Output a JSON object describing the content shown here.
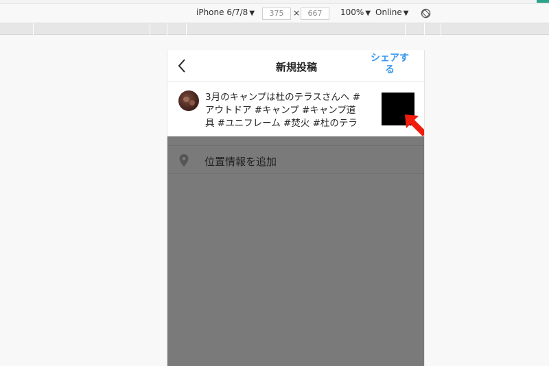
{
  "devtools": {
    "device": "iPhone 6/7/8",
    "width": "375",
    "height": "667",
    "dimension_separator": "×",
    "zoom": "100%",
    "network": "Online",
    "dropdown_glyph": "▼"
  },
  "post": {
    "title": "新規投稿",
    "share_label": "シェアする",
    "caption": "3月のキャンプは杜のテラスさんへ #アウトドア #キャンプ #キャンプ道具 #ユニフレーム #焚火 #杜のテラス",
    "add_location_label": "位置情報を追加"
  },
  "colors": {
    "accent": "#3897f0",
    "overlay": "#7a7a7a",
    "arrow": "#f01c0c"
  }
}
